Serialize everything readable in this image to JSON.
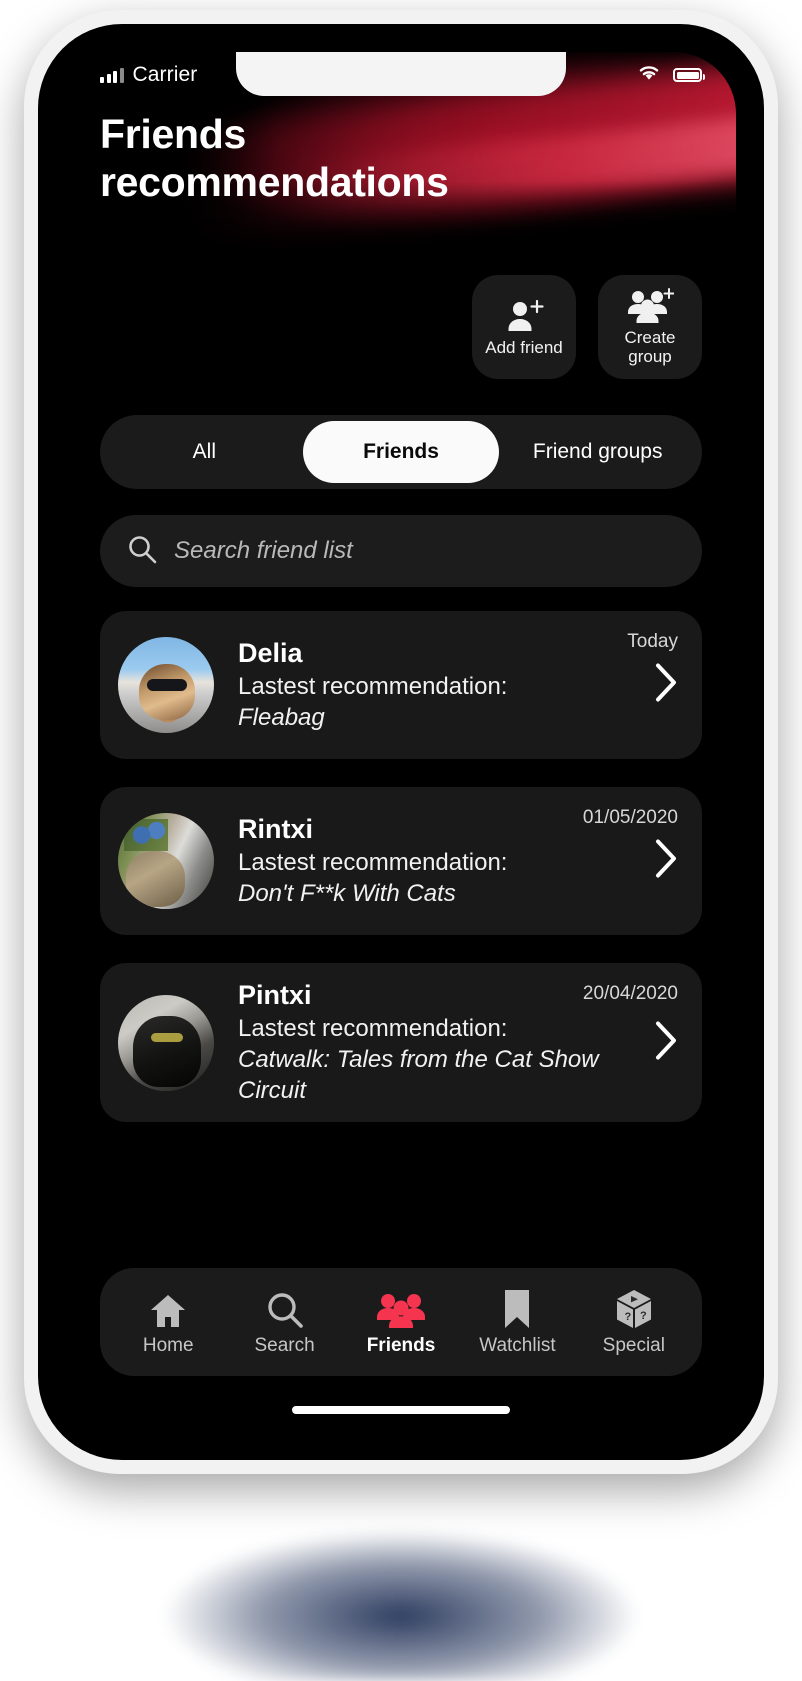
{
  "status_bar": {
    "carrier": "Carrier",
    "signal_icon": "signal-bars-icon",
    "wifi_icon": "wifi-icon",
    "battery_icon": "battery-icon"
  },
  "header": {
    "title_line1": "Friends",
    "title_line2": "recommendations"
  },
  "actions": [
    {
      "label": "Add friend",
      "icon": "add-friend-icon"
    },
    {
      "label": "Create group",
      "icon": "create-group-icon"
    }
  ],
  "segmented": {
    "options": [
      {
        "label": "All",
        "active": false
      },
      {
        "label": "Friends",
        "active": true
      },
      {
        "label": "Friend groups",
        "active": false
      }
    ]
  },
  "search": {
    "icon": "search-icon",
    "placeholder": "Search friend list",
    "value": ""
  },
  "friends": [
    {
      "name": "Delia",
      "rec_label": "Lastest recommendation:",
      "rec_title": "Fleabag",
      "date": "Today",
      "avatar": "avatar-delia",
      "chevron": "chevron-right-icon"
    },
    {
      "name": "Rintxi",
      "rec_label": "Lastest recommendation:",
      "rec_title": "Don't F**k With Cats",
      "date": "01/05/2020",
      "avatar": "avatar-rintxi",
      "chevron": "chevron-right-icon"
    },
    {
      "name": "Pintxi",
      "rec_label": "Lastest recommendation:",
      "rec_title": "Catwalk: Tales from the Cat Show Circuit",
      "date": "20/04/2020",
      "avatar": "avatar-pintxi",
      "chevron": "chevron-right-icon"
    }
  ],
  "tabbar": [
    {
      "label": "Home",
      "icon": "home-icon",
      "active": false
    },
    {
      "label": "Search",
      "icon": "search-icon",
      "active": false
    },
    {
      "label": "Friends",
      "icon": "friends-icon",
      "active": true
    },
    {
      "label": "Watchlist",
      "icon": "bookmark-icon",
      "active": false
    },
    {
      "label": "Special",
      "icon": "mystery-cube-icon",
      "active": false
    }
  ],
  "colors": {
    "accent": "#f5344f",
    "screen_bg": "#000000",
    "card_bg": "#191919",
    "control_bg": "#1b1b1b",
    "active_pill_bg": "#fafafa",
    "hero_beam": "#b4122 8",
    "hero_beam_hex": "#b41228",
    "text_primary": "#ffffff",
    "text_muted": "#c6c6c6"
  }
}
